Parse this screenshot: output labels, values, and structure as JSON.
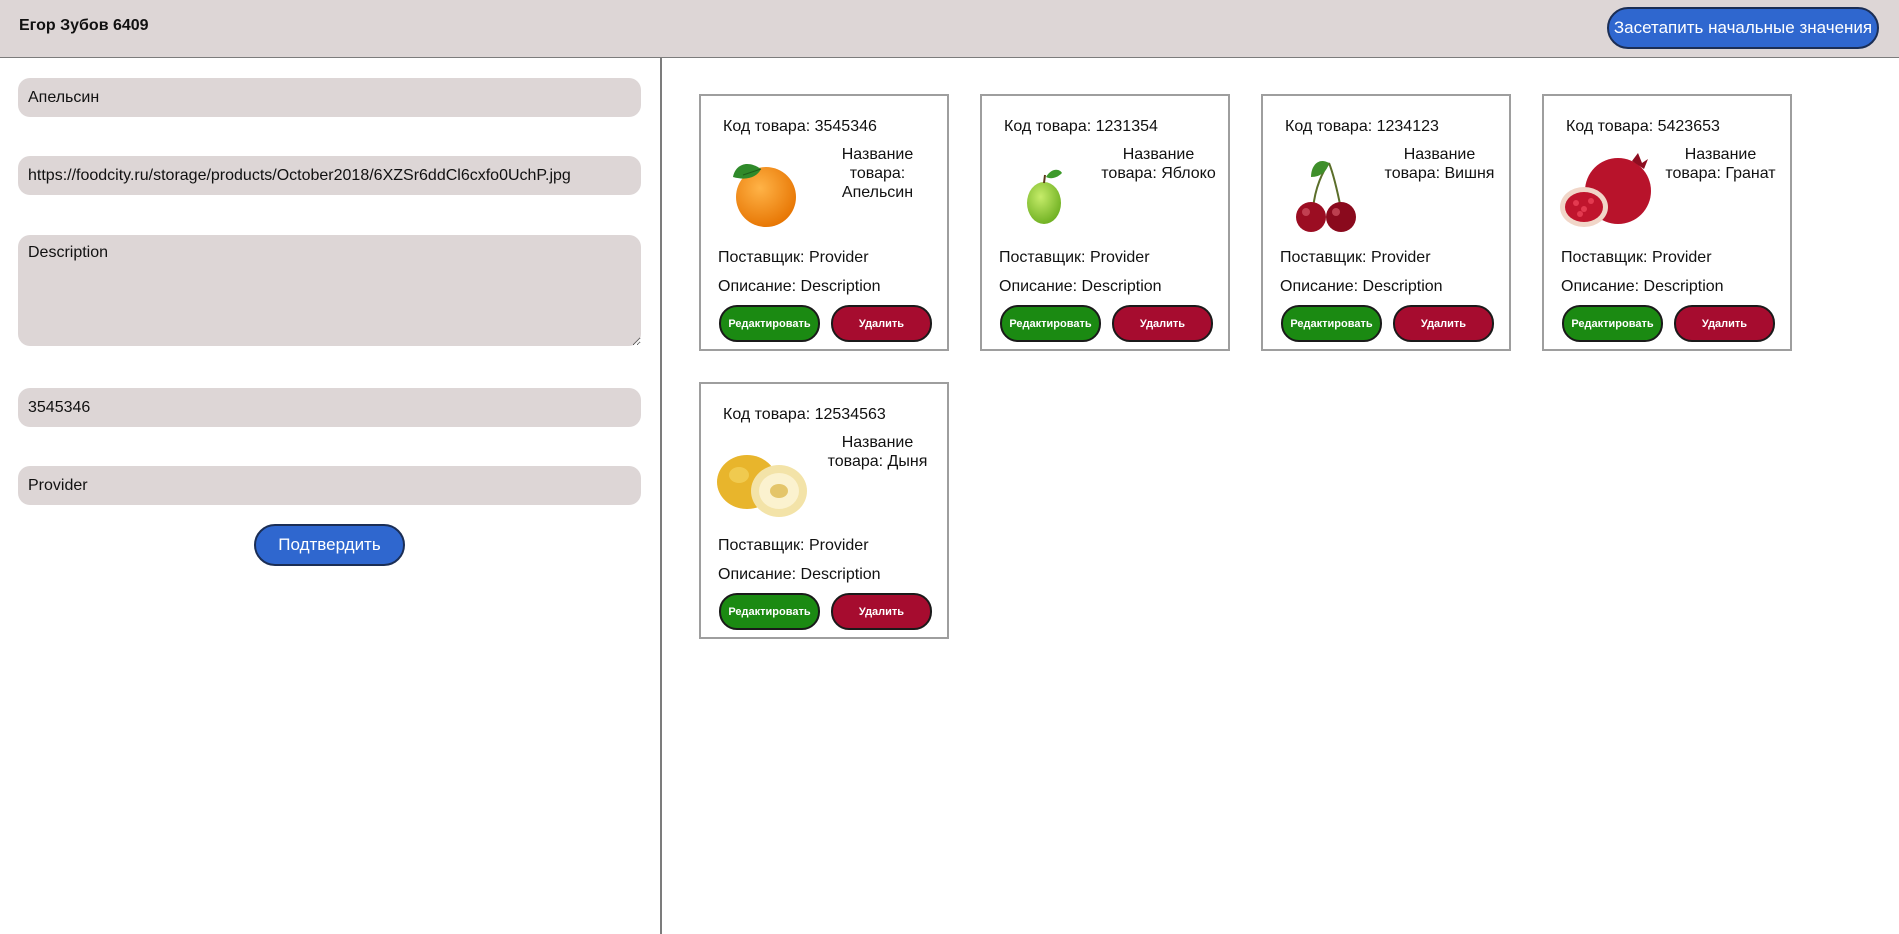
{
  "header": {
    "title": "Егор Зубов 6409",
    "reset_button": "Засетапить начальные значения"
  },
  "form": {
    "name_value": "Апельсин",
    "url_value": "https://foodcity.ru/storage/products/October2018/6XZSr6ddCl6cxfo0UchP.jpg",
    "description_value": "Description",
    "code_value": "3545346",
    "provider_value": "Provider",
    "submit_label": "Подтвердить"
  },
  "cards": [
    {
      "code": "Код товара: 3545346",
      "name": "Название товара: Апельсин",
      "provider": "Поставщик: Provider",
      "description": "Описание: Description",
      "edit": "Редактировать",
      "delete": "Удалить",
      "image": "orange-image"
    },
    {
      "code": "Код товара: 1231354",
      "name": "Название товара: Яблоко",
      "provider": "Поставщик: Provider",
      "description": "Описание: Description",
      "edit": "Редактировать",
      "delete": "Удалить",
      "image": "apple-image"
    },
    {
      "code": "Код товара: 1234123",
      "name": "Название товара: Вишня",
      "provider": "Поставщик: Provider",
      "description": "Описание: Description",
      "edit": "Редактировать",
      "delete": "Удалить",
      "image": "cherry-image"
    },
    {
      "code": "Код товара: 5423653",
      "name": "Название товара: Гранат",
      "provider": "Поставщик: Provider",
      "description": "Описание: Description",
      "edit": "Редактировать",
      "delete": "Удалить",
      "image": "pomegranate-image"
    },
    {
      "code": "Код товара: 12534563",
      "name": "Название товара: Дыня",
      "provider": "Поставщик: Provider",
      "description": "Описание: Description",
      "edit": "Редактировать",
      "delete": "Удалить",
      "image": "melon-image"
    }
  ],
  "colors": {
    "header_bg": "#ddd6d6",
    "primary_button": "#2f67cf",
    "edit_button": "#1b8a12",
    "delete_button": "#a60c2f",
    "field_bg": "#ddd6d6"
  }
}
